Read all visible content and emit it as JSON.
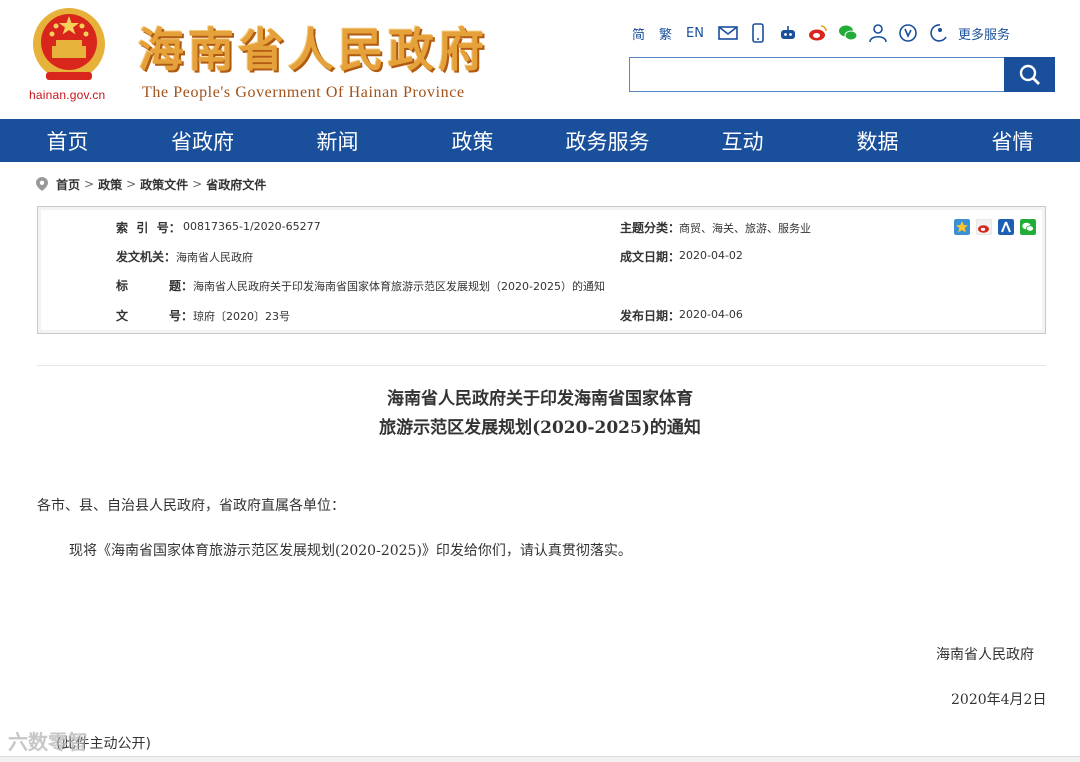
{
  "header": {
    "domain": "hainan.gov.cn",
    "title": "海南省人民政府",
    "subtitle": "The People's Government Of Hainan Province",
    "links": [
      "简",
      "繁",
      "EN"
    ],
    "more_services": "更多服务",
    "icons": [
      "mail-icon",
      "mobile-icon",
      "robot-icon",
      "weibo-icon",
      "wechat-icon",
      "user-icon",
      "accessibility-icon",
      "elderly-icon"
    ]
  },
  "search": {
    "placeholder": ""
  },
  "nav": [
    "首页",
    "省政府",
    "新闻",
    "政策",
    "政务服务",
    "互动",
    "数据",
    "省情"
  ],
  "breadcrumb": [
    "首页",
    "政策",
    "政策文件",
    "省政府文件"
  ],
  "meta": {
    "index_label": "索  引  号：",
    "index_value": "00817365-1/2020-65277",
    "topic_label": "主题分类：",
    "topic_value": "商贸、海关、旅游、服务业",
    "issuer_label": "发文机关：",
    "issuer_value": "海南省人民政府",
    "created_label": "成文日期：",
    "created_value": "2020-04-02",
    "title_label_1": "标",
    "title_label_2": "题：",
    "title_value": "海南省人民政府关于印发海南省国家体育旅游示范区发展规划（2020-2025）的通知",
    "docno_label_1": "文",
    "docno_label_2": "号：",
    "docno_value": "琼府〔2020〕23号",
    "published_label": "发布日期：",
    "published_value": "2020-04-06",
    "share_icons": [
      "qzone-icon",
      "weibo-icon",
      "renren-icon",
      "wechat-icon"
    ]
  },
  "document": {
    "title_line1": "海南省人民政府关于印发海南省国家体育",
    "title_line2": "旅游示范区发展规划(2020-2025)的通知",
    "salutation": "各市、县、自治县人民政府，省政府直属各单位：",
    "body": "现将《海南省国家体育旅游示范区发展规划(2020-2025)》印发给你们，请认真贯彻落实。",
    "signature": "海南省人民政府",
    "date": "2020年4月2日",
    "footer": "(此件主动公开)"
  },
  "watermark": "六数零智"
}
